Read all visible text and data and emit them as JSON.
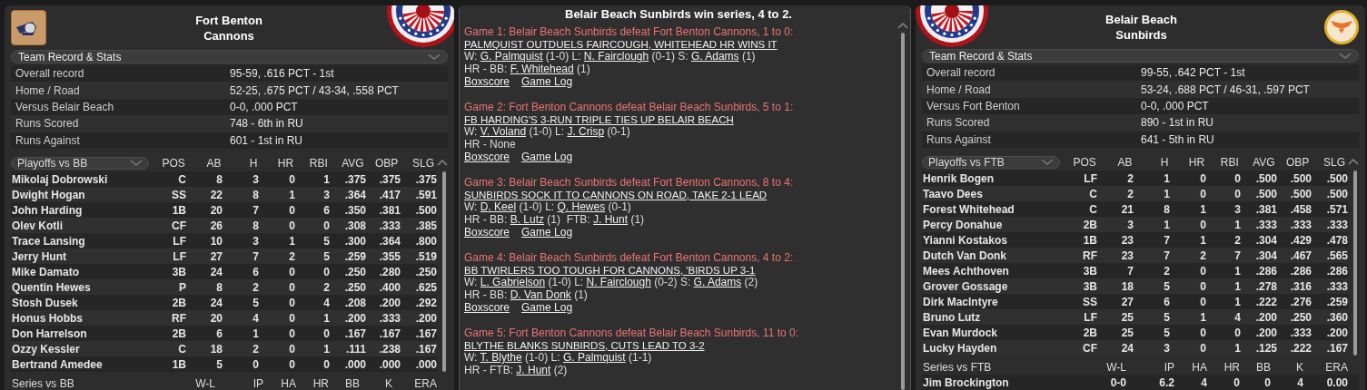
{
  "left_team": {
    "name": [
      "Fort Benton",
      "Cannons"
    ],
    "record": {
      "label": "Team Record & Stats",
      "rows": [
        {
          "label": "Overall record",
          "value": "95-59, .616 PCT - 1st"
        },
        {
          "label": "Home / Road",
          "value": "52-25, .675 PCT / 43-34, .558 PCT"
        },
        {
          "label": "Versus Belair Beach",
          "value": "0-0, .000 PCT"
        },
        {
          "label": "Runs Scored",
          "value": "748 - 6th in RU"
        },
        {
          "label": "Runs Against",
          "value": "601 - 1st in RU"
        }
      ]
    },
    "batting": {
      "columns": [
        "Playoffs vs BB",
        "POS",
        "AB",
        "H",
        "HR",
        "RBI",
        "AVG",
        "OBP",
        "SLG"
      ],
      "rows": [
        [
          "Mikolaj Dobrowski",
          "C",
          "8",
          "3",
          "0",
          "1",
          ".375",
          ".375",
          ".375"
        ],
        [
          "Dwight Hogan",
          "SS",
          "22",
          "8",
          "1",
          "3",
          ".364",
          ".417",
          ".591"
        ],
        [
          "John Harding",
          "1B",
          "20",
          "7",
          "0",
          "6",
          ".350",
          ".381",
          ".500"
        ],
        [
          "Olev Kotli",
          "CF",
          "26",
          "8",
          "0",
          "0",
          ".308",
          ".333",
          ".385"
        ],
        [
          "Trace Lansing",
          "LF",
          "10",
          "3",
          "1",
          "5",
          ".300",
          ".364",
          ".800"
        ],
        [
          "Jerry Hunt",
          "LF",
          "27",
          "7",
          "2",
          "5",
          ".259",
          ".355",
          ".519"
        ],
        [
          "Mike Damato",
          "3B",
          "24",
          "6",
          "0",
          "0",
          ".250",
          ".280",
          ".250"
        ],
        [
          "Quentin Hewes",
          "P",
          "8",
          "2",
          "0",
          "2",
          ".250",
          ".400",
          ".625"
        ],
        [
          "Stosh Dusek",
          "2B",
          "24",
          "5",
          "0",
          "4",
          ".208",
          ".200",
          ".292"
        ],
        [
          "Honus Hobbs",
          "RF",
          "20",
          "4",
          "0",
          "1",
          ".200",
          ".333",
          ".200"
        ],
        [
          "Don Harrelson",
          "2B",
          "6",
          "1",
          "0",
          "0",
          ".167",
          ".167",
          ".167"
        ],
        [
          "Ozzy Kessler",
          "C",
          "18",
          "2",
          "0",
          "1",
          ".111",
          ".238",
          ".167"
        ],
        [
          "Bertrand Amedee",
          "1B",
          "5",
          "0",
          "0",
          "0",
          ".000",
          ".000",
          ".000"
        ]
      ]
    },
    "pitching": {
      "columns": [
        "Series vs BB",
        "W-L",
        "IP",
        "HA",
        "HR",
        "BB",
        "K",
        "ERA"
      ]
    }
  },
  "series": {
    "title": "Belair Beach Sunbirds win series, 4 to 2.",
    "games": [
      {
        "result": "Game 1: Belair Beach Sunbirds defeat Fort Benton Cannons, 1 to 0:",
        "headline": "PALMQUIST OUTDUELS FAIRCOUGH, WHITEHEAD HR WINS IT",
        "lines": [
          [
            {
              "text": "W: ",
              "link": false
            },
            {
              "text": "G. Palmquist",
              "link": true
            },
            {
              "text": " (1-0) L: ",
              "link": false
            },
            {
              "text": "N. Fairclough",
              "link": true
            },
            {
              "text": " (0-1) S: ",
              "link": false
            },
            {
              "text": "G. Adams",
              "link": true
            },
            {
              "text": " (1)",
              "link": false
            }
          ],
          [
            {
              "text": "HR - BB: ",
              "link": false
            },
            {
              "text": "F. Whitehead",
              "link": true
            },
            {
              "text": " (1)",
              "link": false
            }
          ]
        ],
        "links": [
          "Boxscore",
          "Game Log"
        ]
      },
      {
        "result": "Game 2: Fort Benton Cannons defeat Belair Beach Sunbirds, 5 to 1:",
        "headline": "FB HARDING'S 3-RUN TRIPLE TIES UP BELAIR BEACH",
        "lines": [
          [
            {
              "text": "W: ",
              "link": false
            },
            {
              "text": "V. Voland",
              "link": true
            },
            {
              "text": " (1-0) L: ",
              "link": false
            },
            {
              "text": "J. Crisp",
              "link": true
            },
            {
              "text": " (0-1)",
              "link": false
            }
          ],
          [
            {
              "text": "HR - None",
              "link": false
            }
          ]
        ],
        "links": [
          "Boxscore",
          "Game Log"
        ]
      },
      {
        "result": "Game 3: Belair Beach Sunbirds defeat Fort Benton Cannons, 8 to 4:",
        "headline": "SUNBIRDS SOCK IT TO CANNONS ON ROAD, TAKE 2-1 LEAD",
        "lines": [
          [
            {
              "text": "W: ",
              "link": false
            },
            {
              "text": "D. Keel",
              "link": true
            },
            {
              "text": " (1-0) L: ",
              "link": false
            },
            {
              "text": "Q. Hewes",
              "link": true
            },
            {
              "text": " (0-1)",
              "link": false
            }
          ],
          [
            {
              "text": "HR - BB: ",
              "link": false
            },
            {
              "text": "B. Lutz",
              "link": true
            },
            {
              "text": " (1)  FTB: ",
              "link": false
            },
            {
              "text": "J. Hunt",
              "link": true
            },
            {
              "text": " (1)",
              "link": false
            }
          ]
        ],
        "links": [
          "Boxscore",
          "Game Log"
        ]
      },
      {
        "result": "Game 4: Belair Beach Sunbirds defeat Fort Benton Cannons, 4 to 2:",
        "headline": "BB TWIRLERS TOO TOUGH FOR CANNONS, 'BIRDS UP 3-1",
        "lines": [
          [
            {
              "text": "W: ",
              "link": false
            },
            {
              "text": "L. Gabrielson",
              "link": true
            },
            {
              "text": " (1-0) L: ",
              "link": false
            },
            {
              "text": "N. Fairclough",
              "link": true
            },
            {
              "text": " (0-2) S: ",
              "link": false
            },
            {
              "text": "G. Adams",
              "link": true
            },
            {
              "text": " (2)",
              "link": false
            }
          ],
          [
            {
              "text": "HR - BB: ",
              "link": false
            },
            {
              "text": "D. Van Donk",
              "link": true
            },
            {
              "text": " (1)",
              "link": false
            }
          ]
        ],
        "links": [
          "Boxscore",
          "Game Log"
        ]
      },
      {
        "result": "Game 5: Fort Benton Cannons defeat Belair Beach Sunbirds, 11 to 0:",
        "headline": "BLYTHE BLANKS SUNBIRDS, CUTS LEAD TO 3-2",
        "lines": [
          [
            {
              "text": "W: ",
              "link": false
            },
            {
              "text": "T. Blythe",
              "link": true
            },
            {
              "text": " (1-0) L: ",
              "link": false
            },
            {
              "text": "G. Palmquist",
              "link": true
            },
            {
              "text": " (1-1)",
              "link": false
            }
          ],
          [
            {
              "text": "HR - FTB: ",
              "link": false
            },
            {
              "text": "J. Hunt",
              "link": true
            },
            {
              "text": " (2)",
              "link": false
            }
          ]
        ]
      }
    ]
  },
  "right_team": {
    "name": [
      "Belair Beach",
      "Sunbirds"
    ],
    "record": {
      "label": "Team Record & Stats",
      "rows": [
        {
          "label": "Overall record",
          "value": "99-55, .642 PCT - 1st"
        },
        {
          "label": "Home / Road",
          "value": "53-24, .688 PCT / 46-31, .597 PCT"
        },
        {
          "label": "Versus Fort Benton",
          "value": "0-0, .000 PCT"
        },
        {
          "label": "Runs Scored",
          "value": "890 - 1st in RU"
        },
        {
          "label": "Runs Against",
          "value": "641 - 5th in RU"
        }
      ]
    },
    "batting": {
      "columns": [
        "Playoffs vs FTB",
        "POS",
        "AB",
        "H",
        "HR",
        "RBI",
        "AVG",
        "OBP",
        "SLG"
      ],
      "rows": [
        [
          "Henrik Bogen",
          "LF",
          "2",
          "1",
          "0",
          "0",
          ".500",
          ".500",
          ".500"
        ],
        [
          "Taavo Dees",
          "C",
          "2",
          "1",
          "0",
          "0",
          ".500",
          ".500",
          ".500"
        ],
        [
          "Forest Whitehead",
          "C",
          "21",
          "8",
          "1",
          "3",
          ".381",
          ".458",
          ".571"
        ],
        [
          "Percy Donahue",
          "2B",
          "3",
          "1",
          "0",
          "1",
          ".333",
          ".333",
          ".333"
        ],
        [
          "Yianni Kostakos",
          "1B",
          "23",
          "7",
          "1",
          "2",
          ".304",
          ".429",
          ".478"
        ],
        [
          "Dutch Van Donk",
          "RF",
          "23",
          "7",
          "2",
          "7",
          ".304",
          ".467",
          ".565"
        ],
        [
          "Mees Achthoven",
          "3B",
          "7",
          "2",
          "0",
          "1",
          ".286",
          ".286",
          ".286"
        ],
        [
          "Grover Gossage",
          "3B",
          "18",
          "5",
          "0",
          "1",
          ".278",
          ".316",
          ".333"
        ],
        [
          "Dirk MacIntyre",
          "SS",
          "27",
          "6",
          "0",
          "1",
          ".222",
          ".276",
          ".259"
        ],
        [
          "Bruno Lutz",
          "LF",
          "25",
          "5",
          "1",
          "4",
          ".200",
          ".250",
          ".360"
        ],
        [
          "Evan Murdock",
          "2B",
          "25",
          "5",
          "0",
          "0",
          ".200",
          ".333",
          ".200"
        ],
        [
          "Lucky Hayden",
          "CF",
          "24",
          "3",
          "0",
          "1",
          ".125",
          ".222",
          ".167"
        ]
      ]
    },
    "pitching": {
      "columns": [
        "Series vs FTB",
        "W-L",
        "IP",
        "HA",
        "HR",
        "BB",
        "K",
        "ERA"
      ],
      "rows": [
        [
          "Jim Brockington",
          "0-0",
          "6.2",
          "4",
          "0",
          "0",
          "4",
          "0.00"
        ]
      ]
    }
  }
}
